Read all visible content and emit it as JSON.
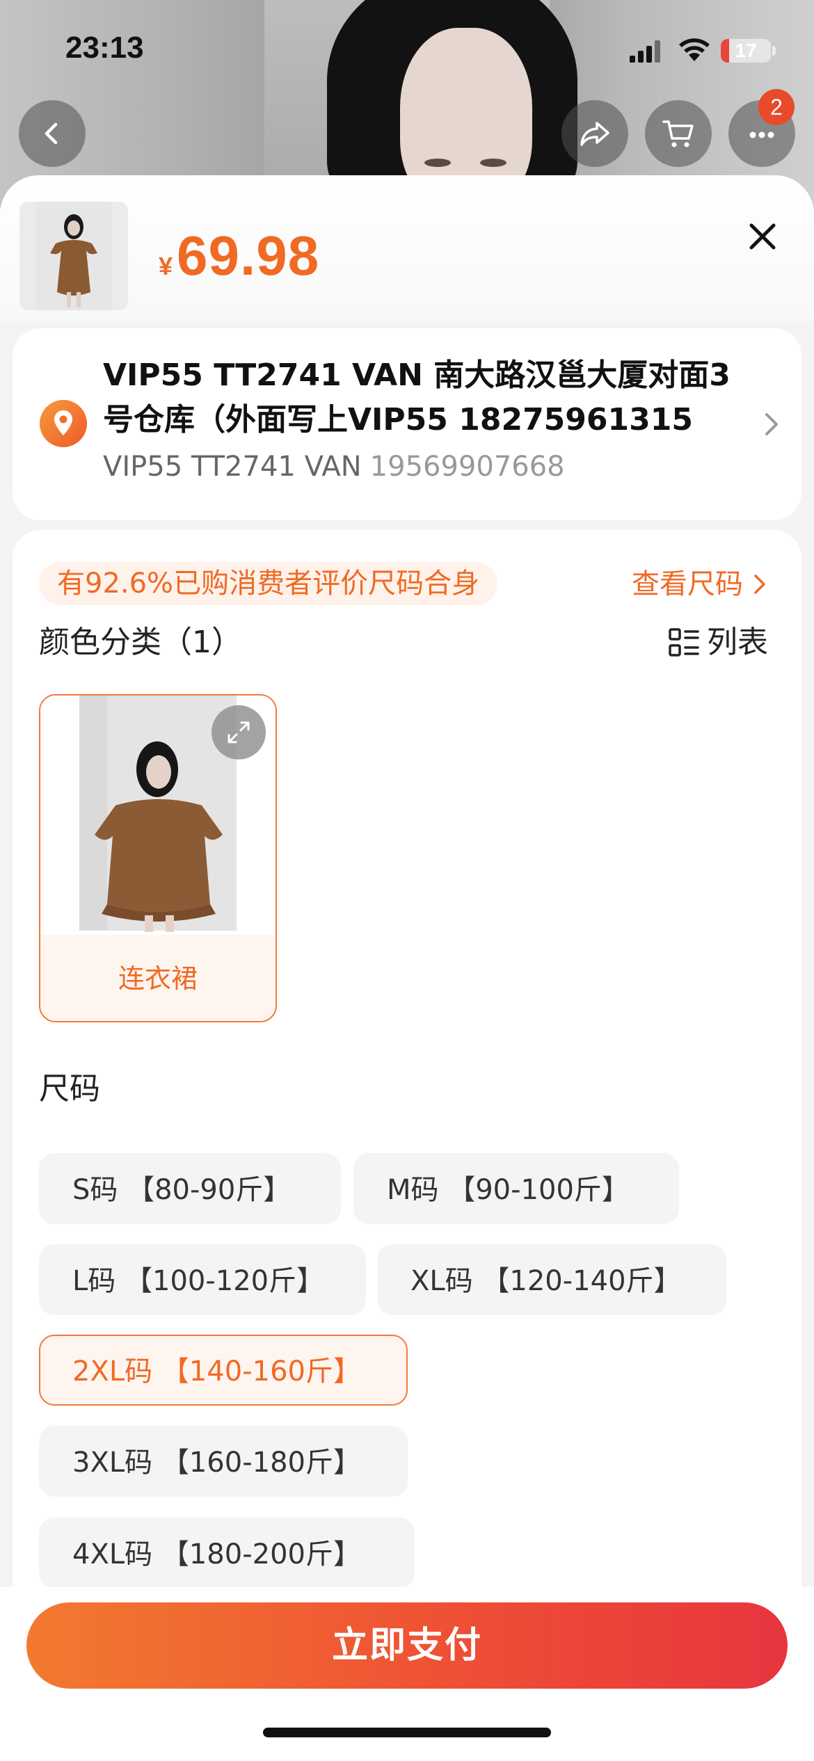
{
  "status_bar": {
    "time": "23:13",
    "battery_level": "17",
    "battery_fraction": 0.17
  },
  "header_nav": {
    "back_icon": "chevron-left-icon",
    "share_icon": "share-arrow-icon",
    "cart_icon": "cart-icon",
    "more_icon": "more-dots-icon",
    "notification_count": "2"
  },
  "product": {
    "currency_symbol": "¥",
    "price": "69.98"
  },
  "address": {
    "line": "VIP55 TT2741 VAN 南大路汉邕大厦对面3号仓库（外面写上VIP55 18275961315",
    "recipient": "VIP55 TT2741 VAN",
    "phone": "19569907668"
  },
  "options": {
    "fit_note": "有92.6%已购消费者评价尺码合身",
    "size_chart_link": "查看尺码",
    "color_section_title": "颜色分类（1）",
    "list_view_label": "列表",
    "colors": [
      {
        "label": "连衣裙",
        "selected": true
      }
    ],
    "size_section_title": "尺码",
    "sizes": [
      {
        "label": "S码 【80-90斤】",
        "selected": false
      },
      {
        "label": "M码 【90-100斤】",
        "selected": false
      },
      {
        "label": "L码 【100-120斤】",
        "selected": false
      },
      {
        "label": "XL码 【120-140斤】",
        "selected": false
      },
      {
        "label": "2XL码 【140-160斤】",
        "selected": true
      },
      {
        "label": "3XL码 【160-180斤】",
        "selected": false
      },
      {
        "label": "4XL码 【180-200斤】",
        "selected": false
      }
    ]
  },
  "footer": {
    "pay_button": "立即支付"
  },
  "colors": {
    "accent": "#f06a25",
    "pay_gradient_start": "#f27a2f",
    "pay_gradient_end": "#e8353f",
    "badge": "#e84a2a"
  }
}
